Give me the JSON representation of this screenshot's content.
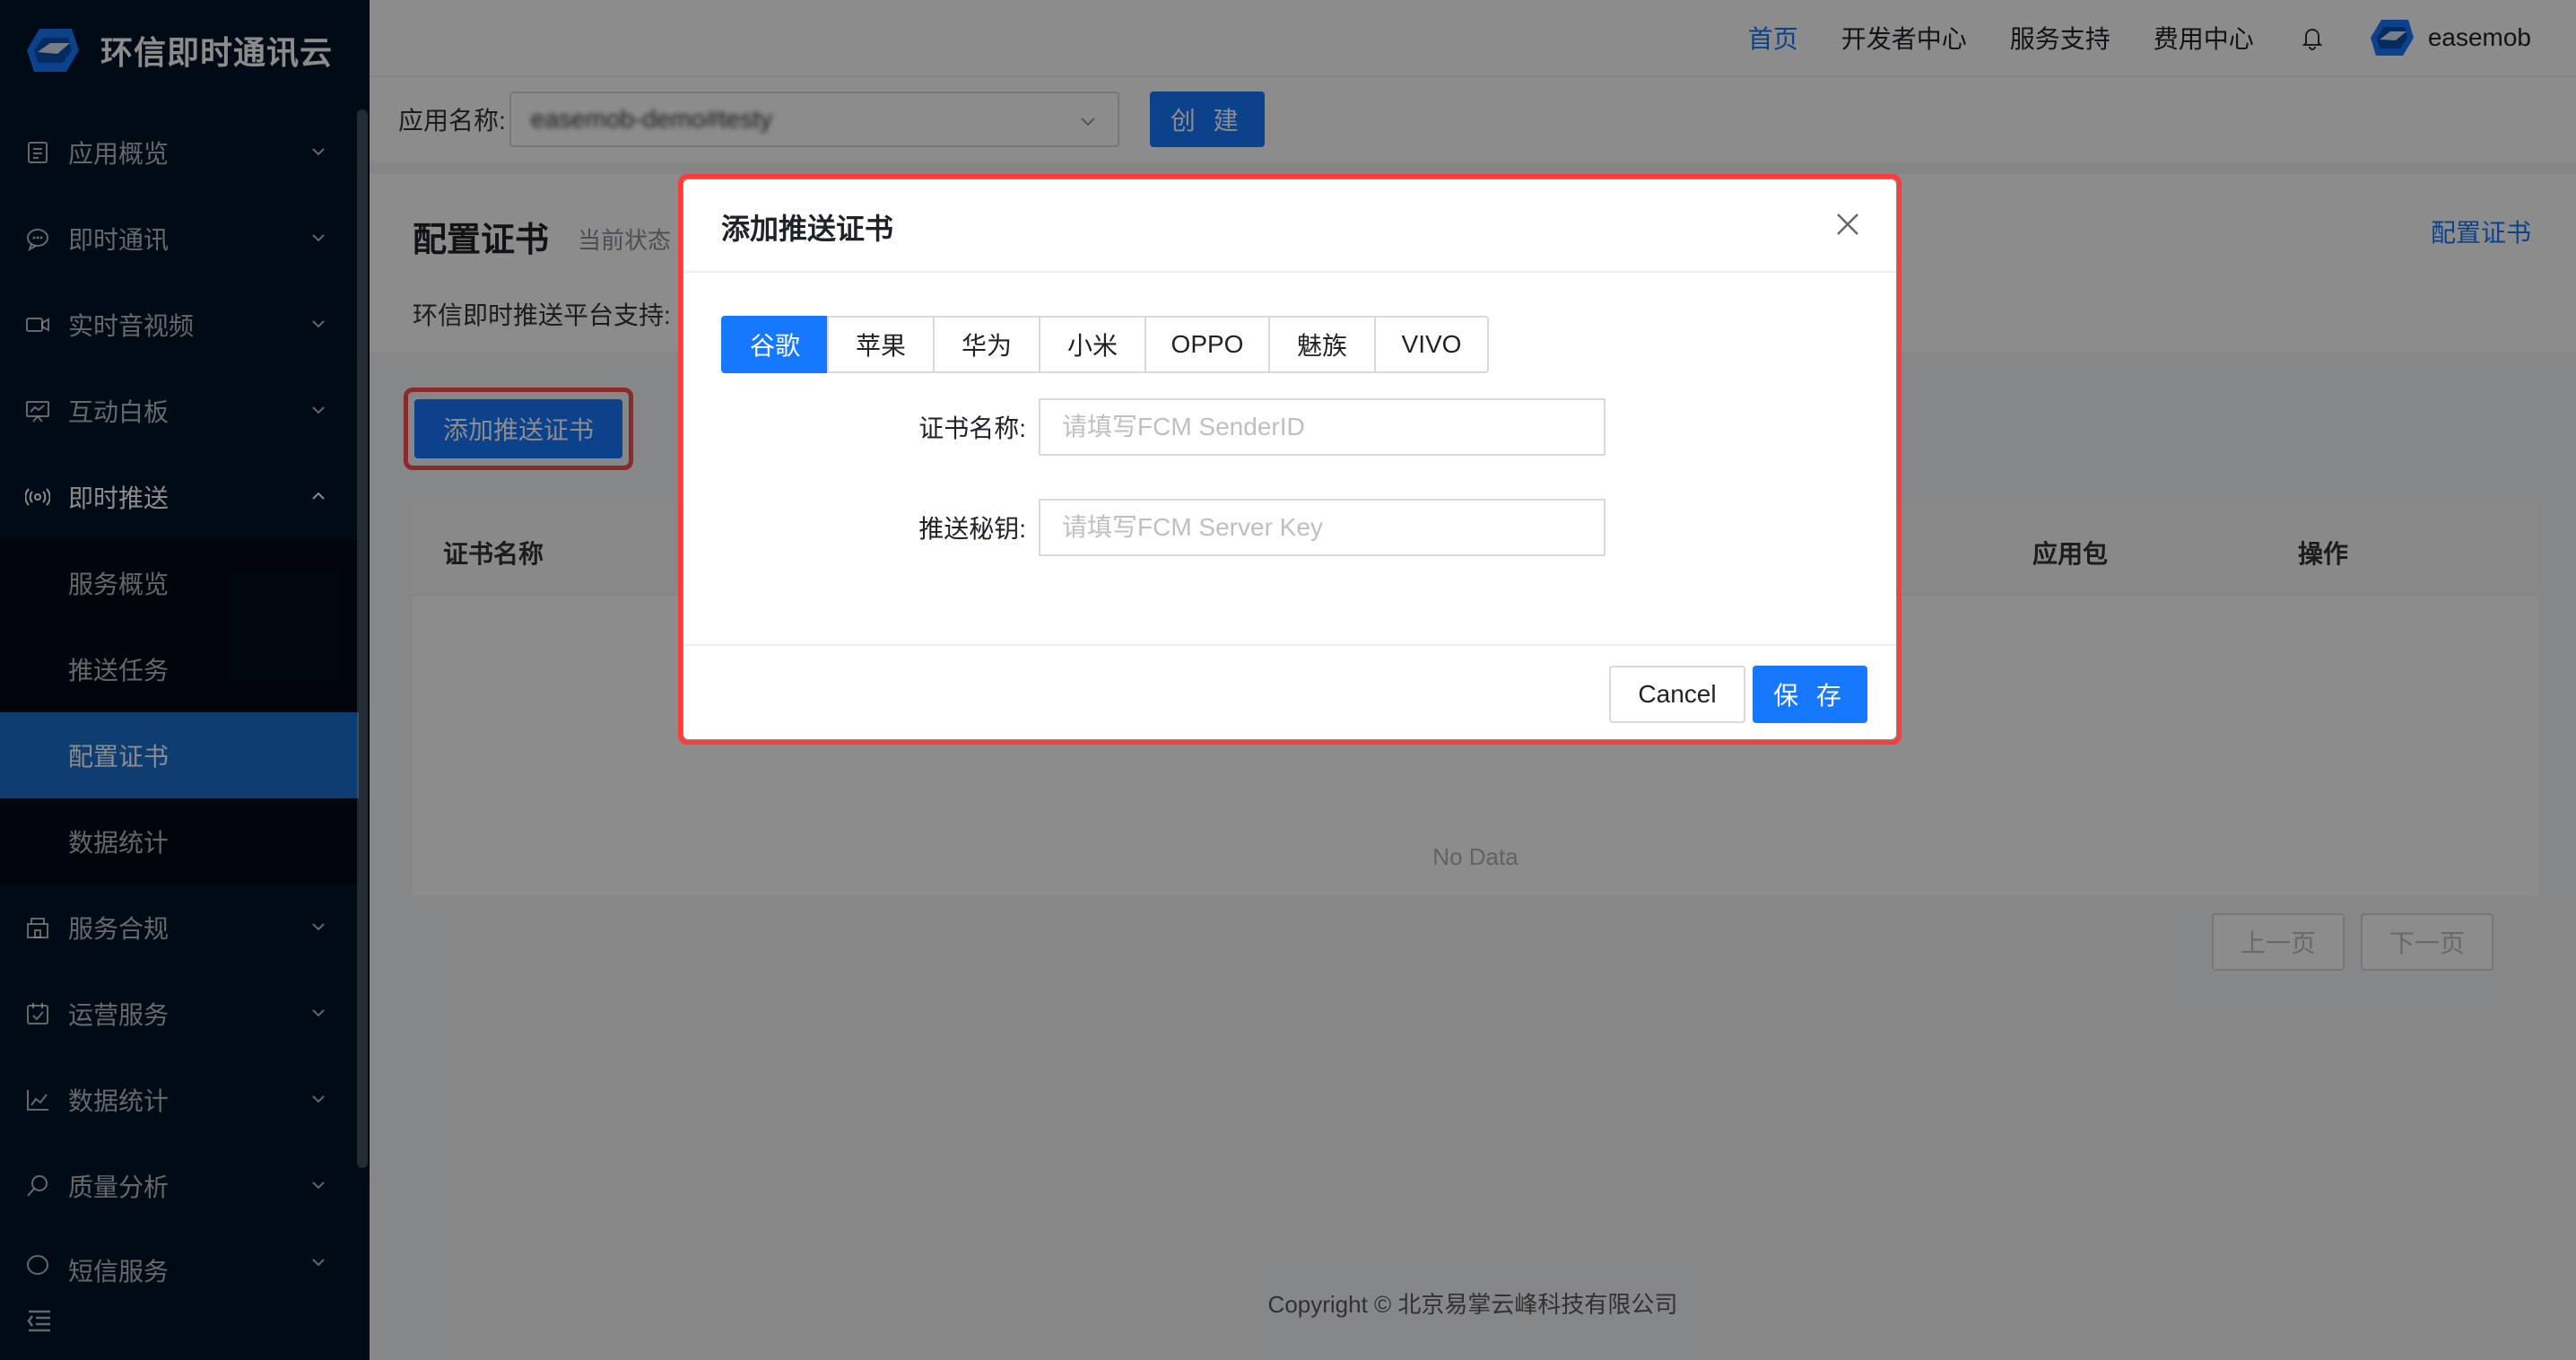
{
  "brand": {
    "name": "环信即时通讯云"
  },
  "sidebar": {
    "items": [
      {
        "label": "应用概览",
        "icon": "doc-icon"
      },
      {
        "label": "即时通讯",
        "icon": "chat-icon"
      },
      {
        "label": "实时音视频",
        "icon": "video-icon"
      },
      {
        "label": "互动白板",
        "icon": "whiteboard-icon"
      },
      {
        "label": "即时推送",
        "icon": "push-icon",
        "open": true
      },
      {
        "label": "服务合规",
        "icon": "building-icon"
      },
      {
        "label": "运营服务",
        "icon": "calendar-icon"
      },
      {
        "label": "数据统计",
        "icon": "chart-icon"
      },
      {
        "label": "质量分析",
        "icon": "search-icon"
      },
      {
        "label": "短信服务",
        "icon": "sms-icon"
      }
    ],
    "sub_items": [
      "服务概览",
      "推送任务",
      "配置证书",
      "数据统计"
    ],
    "active_sub": "配置证书"
  },
  "header": {
    "nav": [
      "首页",
      "开发者中心",
      "服务支持",
      "费用中心"
    ],
    "active": "首页",
    "user": "easemob"
  },
  "toolbar": {
    "app_label": "应用名称:",
    "app_value": "easemob-demo#testy",
    "create_label": "创 建"
  },
  "page": {
    "title": "配置证书",
    "state": "当前状态",
    "link": "配置证书",
    "platforms_label": "环信即时推送平台支持:",
    "add_button": "添加推送证书",
    "table_headers": [
      "证书名称",
      "应用包",
      "操作"
    ],
    "no_data": "No Data",
    "prev_page": "上一页",
    "next_page": "下一页",
    "footer": "Copyright © 北京易掌云峰科技有限公司"
  },
  "modal": {
    "title": "添加推送证书",
    "tabs": [
      "谷歌",
      "苹果",
      "华为",
      "小米",
      "OPPO",
      "魅族",
      "VIVO"
    ],
    "active_tab": "谷歌",
    "fields": [
      {
        "label": "证书名称:",
        "placeholder": "请填写FCM SenderID",
        "value": ""
      },
      {
        "label": "推送秘钥:",
        "placeholder": "请填写FCM Server Key",
        "value": ""
      }
    ],
    "cancel": "Cancel",
    "save": "保 存"
  },
  "colors": {
    "sidebar_bg": "#001529",
    "primary": "#1677ff",
    "highlight": "#ff3b3b"
  }
}
